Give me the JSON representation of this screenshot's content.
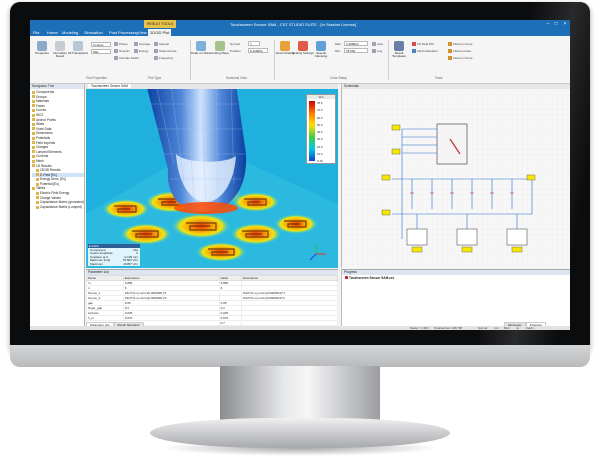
{
  "window": {
    "title": "Touchscreen Sensor SAM - CST STUDIO SUITE - [In Session License]",
    "context_tab": "RESULT TOOLS",
    "context_subtab": "2D/3D Plot"
  },
  "menu": [
    "File",
    "Home",
    "Modeling",
    "Simulation",
    "Post Processing",
    "View",
    "2D/3D Plot"
  ],
  "ribbon": {
    "buttons": [
      {
        "label": "Properties"
      },
      {
        "label": "Normalize Result"
      },
      {
        "label": "All Transparent"
      },
      {
        "label": "Fields on Plane"
      },
      {
        "label": "Cutting Plane"
      },
      {
        "label": "Smart Scaling"
      },
      {
        "label": "Scaling Settings"
      },
      {
        "label": "Special Clamping"
      },
      {
        "label": "Result Templates"
      }
    ],
    "small_items": [
      "Phase",
      "Smooth",
      "Animate Fields",
      "Average",
      "Energy",
      "Sample",
      "Scale Arrows",
      "Frequency",
      "Normal",
      "Position",
      "Auto",
      "Log.",
      "1D Field Plot",
      "Field Calculator",
      "Field on Curve",
      "Field on Face",
      "Field on Curve"
    ],
    "fields": {
      "plot_mode": "Contour",
      "plot_type": "Max",
      "normal": "Y",
      "position": "0.129604",
      "max": "3.188914",
      "min": "78.562"
    },
    "groups": [
      "Plot Properties",
      "Plot Type",
      "Sectional View",
      "Color Ramp",
      "Tools"
    ]
  },
  "nav_tree": {
    "header": "Navigation Tree",
    "items": [
      "Components",
      "Groups",
      "Materials",
      "Faces",
      "Curves",
      "WCS",
      "Anchor Points",
      "Wires",
      "Voxel Data",
      "Dimensions",
      "Potentials",
      "Field Imprints",
      "Charges",
      "Lumped Elements",
      "Currents",
      "Mesh",
      "1D Results",
      "2D/3D Results",
      "E-Field [Es]",
      "Energy Dens. [Es]",
      "Potential [Es]",
      "Tables",
      "Electric Field Energy",
      "Charge Values",
      "Capacitance Matrix (grounded)",
      "Capacitance Matrix (Lumped)"
    ]
  },
  "viewport": {
    "tab": "Touchscreen Sensor SAM",
    "info": {
      "title": "E-Field",
      "rows": [
        {
          "k": "Component",
          "v": "Abs"
        },
        {
          "k": "Colour amplitude",
          "v": "0"
        },
        {
          "k": "Cutplane at Z",
          "v": "-0.129 mm"
        },
        {
          "k": "Maximum [Cut]",
          "v": "78.562 V/m"
        },
        {
          "k": "Maximum",
          "v": "26357 V/m"
        }
      ]
    },
    "legend": {
      "title": "V/m",
      "values": [
        "78.6",
        "70.0",
        "60.0",
        "50.0",
        "40.0",
        "30.0",
        "20.0",
        "10.0",
        "3.19"
      ]
    }
  },
  "schematic": {
    "tab": "Schematic"
  },
  "param_list": {
    "header": "Parameter List",
    "columns": [
      "Name",
      "Expression",
      "Value",
      "Description"
    ],
    "rows": [
      {
        "name": "m",
        "expr": "0.895",
        "value": "0.895",
        "desc": ""
      },
      {
        "name": "n",
        "expr": "6",
        "value": "6",
        "desc": ""
      },
      {
        "name": "hmove_1",
        "expr": "Pitch*(1-n)-nm/m(0.0000001)*1",
        "value": "",
        "desc": "Pitch*(1-n)-nm/m(0.0000001)*1"
      },
      {
        "name": "hmove_2",
        "expr": "Pitch*(1-n)-nm/m(0.0000001)*2",
        "value": "",
        "desc": "Pitch*(1-n)-nm/m(0.0000001)*2"
      },
      {
        "name": "gap",
        "expr": "0.05",
        "value": "0.05",
        "desc": ""
      },
      {
        "name": "finger_gap",
        "expr": "0.2",
        "value": "0.2",
        "desc": ""
      },
      {
        "name": "emboss",
        "expr": "0.025",
        "value": "0.025",
        "desc": ""
      },
      {
        "name": "h_cr",
        "expr": "0.070",
        "value": "0.070",
        "desc": ""
      },
      {
        "name": "h_cr2",
        "expr": "0.7",
        "value": "0.7",
        "desc": ""
      },
      {
        "name": "Pitch",
        "expr": "6",
        "value": "6",
        "desc": ""
      }
    ],
    "tabs": [
      "Parameter List",
      "Result Navigator"
    ]
  },
  "progress_panel": {
    "header": "Progress",
    "item": "Touchscreen Sensor SAM.cst",
    "tabs": [
      "Messages",
      "Progress"
    ]
  },
  "status": {
    "items": [
      "Raster = 1.000",
      "Tetrahedrons: 448,798",
      "Normal",
      "mm",
      "MHz",
      "ns",
      "Kelvin"
    ]
  }
}
